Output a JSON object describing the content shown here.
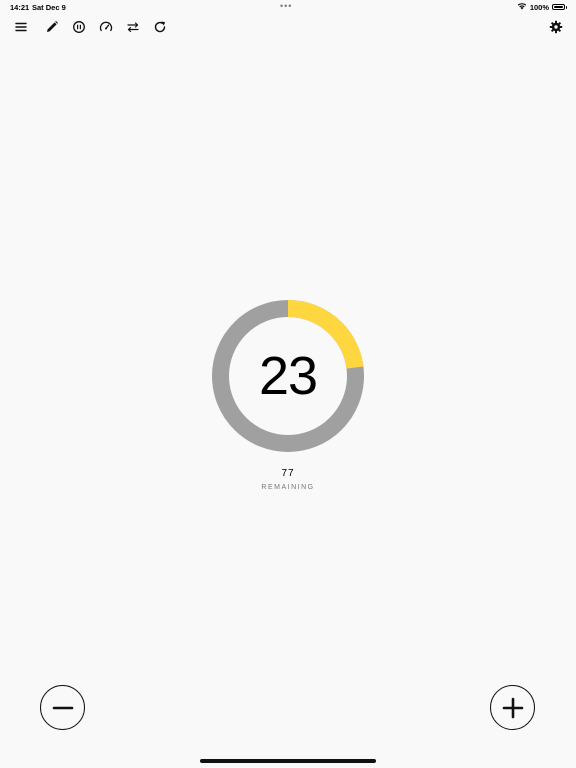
{
  "status_bar": {
    "time": "14:21",
    "date": "Sat Dec 9",
    "multitask_dots": "•••",
    "battery_percent": "100%"
  },
  "toolbar": {
    "icons": [
      "menu-icon",
      "pencil-icon",
      "history-icon",
      "speedometer-icon",
      "swap-arrows-icon",
      "refresh-icon",
      "gear-icon"
    ]
  },
  "counter": {
    "value": "23",
    "progress_fraction": 0.23,
    "remaining_value": "77",
    "remaining_label": "REMAINING",
    "progress_color": "#fed63f",
    "track_color": "#a0a0a0"
  },
  "controls": {
    "decrement_icon": "minus-icon",
    "increment_icon": "plus-icon"
  }
}
